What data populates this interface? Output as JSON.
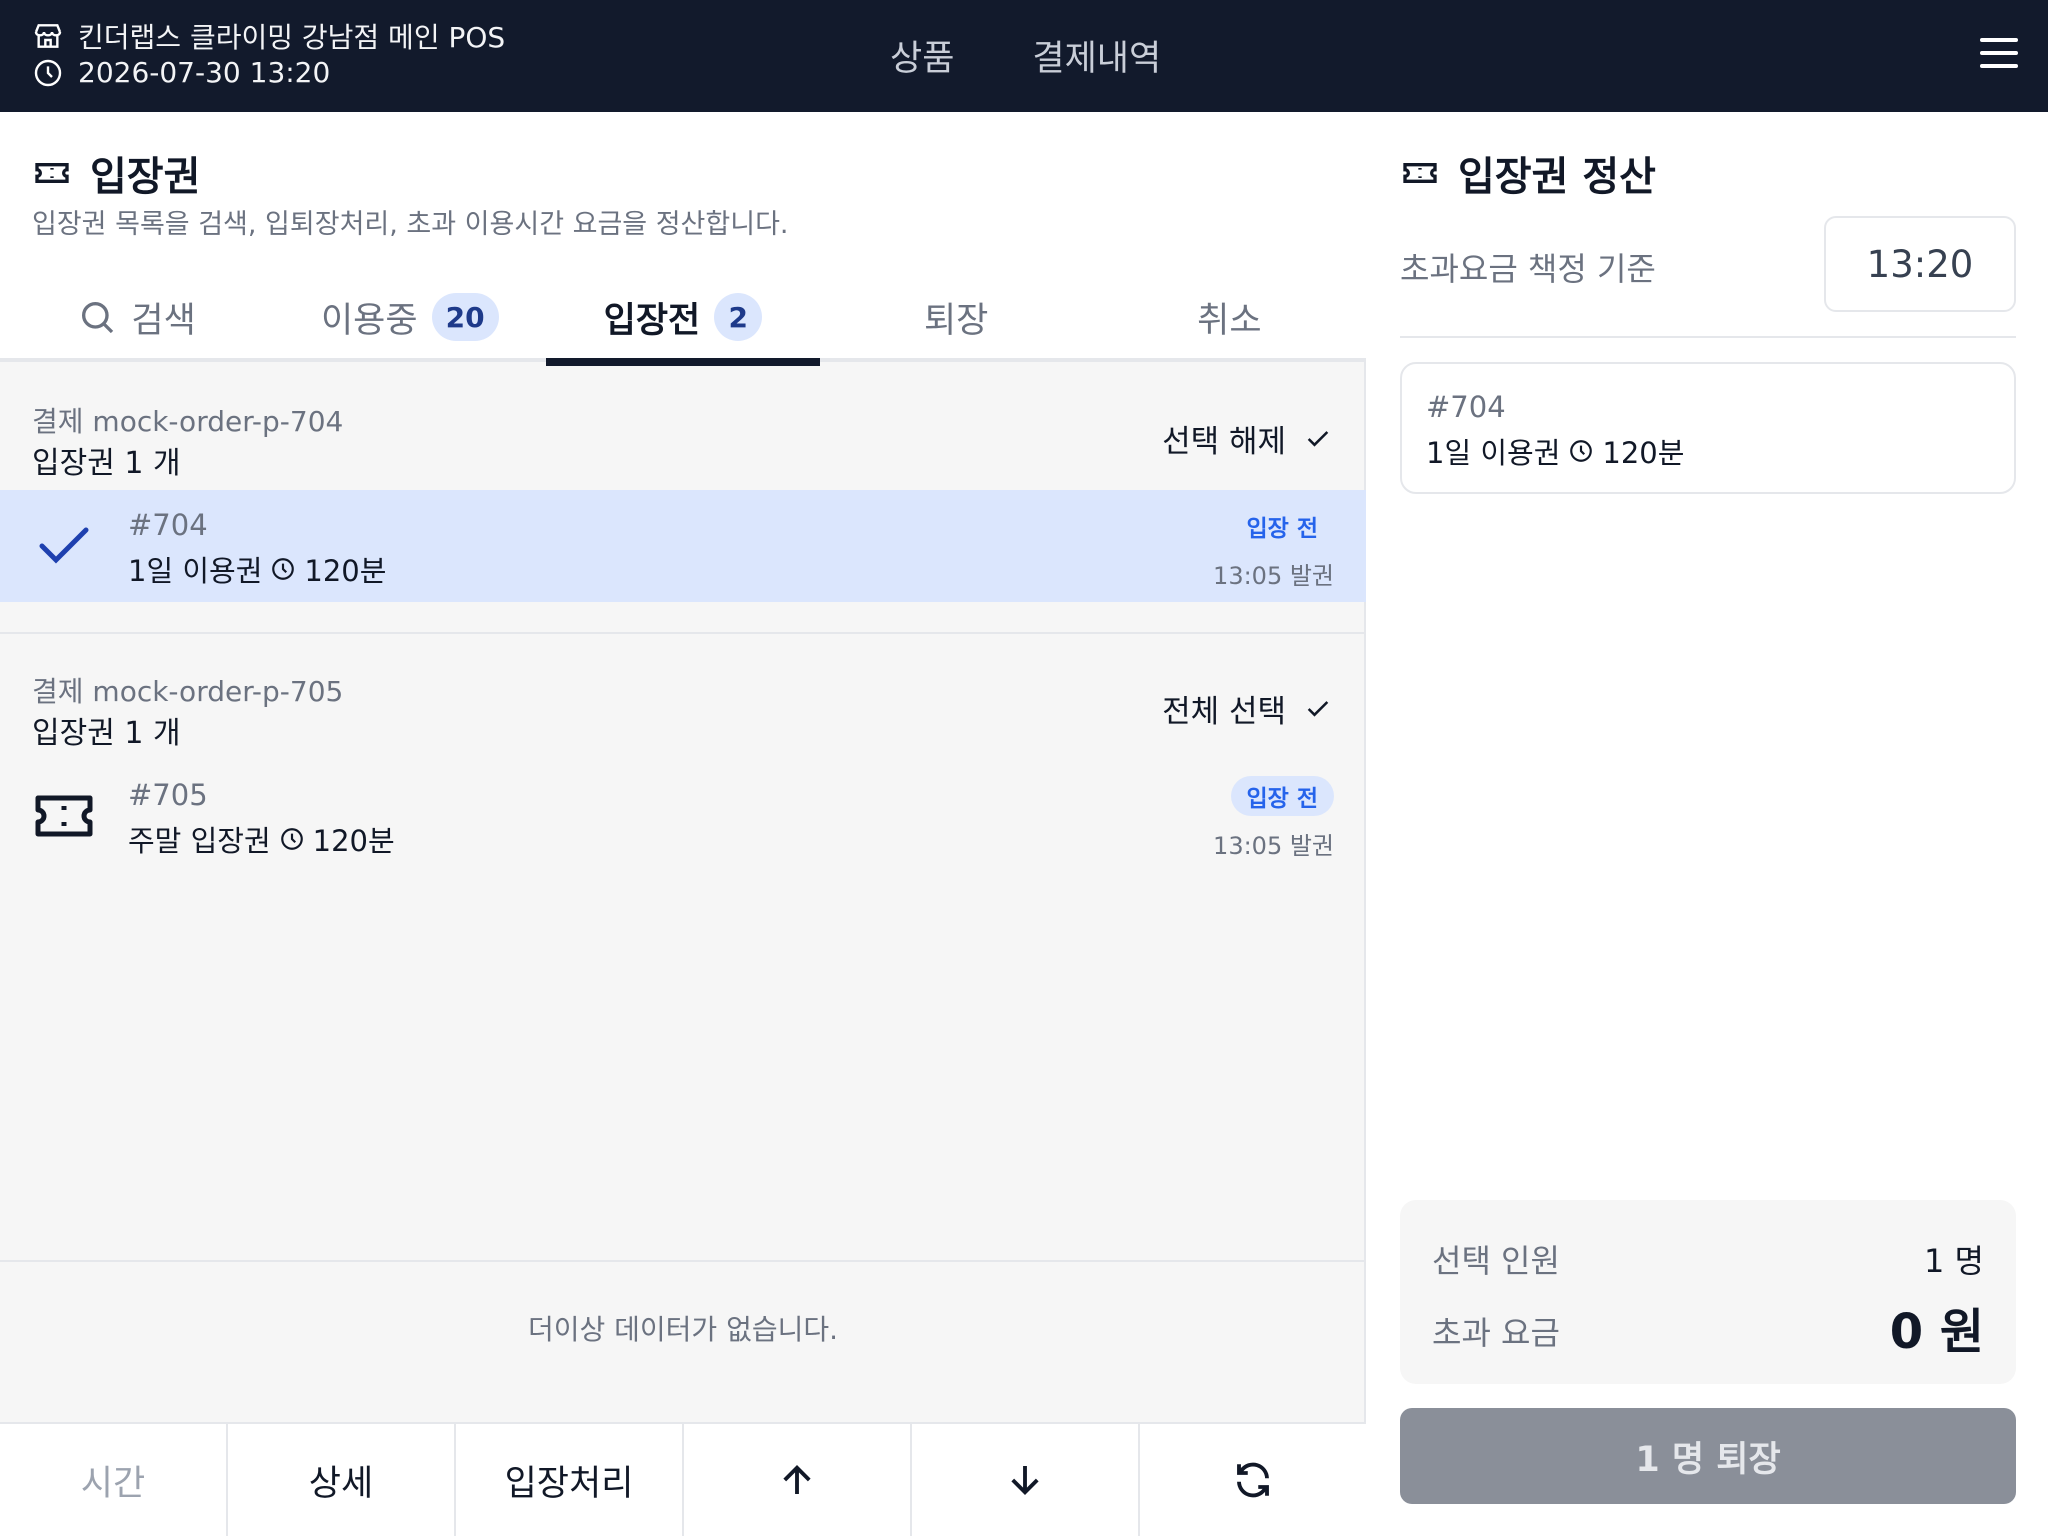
{
  "header": {
    "store_name": "킨더랩스 클라이밍 강남점 메인 POS",
    "datetime": "2026-07-30 13:20",
    "nav": [
      {
        "label": "상품"
      },
      {
        "label": "결제내역"
      }
    ],
    "icons": {
      "store": "store-icon",
      "clock": "clock-icon",
      "menu": "menu-icon"
    }
  },
  "left": {
    "title": "입장권",
    "subtitle": "입장권 목록을 검색, 입퇴장처리, 초과 이용시간 요금을 정산합니다.",
    "tabs": [
      {
        "label": "검색",
        "icon": "search-icon"
      },
      {
        "label": "이용중",
        "badge": "20"
      },
      {
        "label": "입장전",
        "badge": "2",
        "active": true
      },
      {
        "label": "퇴장"
      },
      {
        "label": "취소"
      }
    ],
    "groups": [
      {
        "order": "결제 mock-order-p-704",
        "count": "입장권 1 개",
        "select_label": "선택 해제",
        "tickets": [
          {
            "id": "#704",
            "product": "1일 이용권",
            "duration": "120분",
            "status": "입장 전",
            "issued": "13:05 발권",
            "selected": true
          }
        ]
      },
      {
        "order": "결제 mock-order-p-705",
        "count": "입장권 1 개",
        "select_label": "전체 선택",
        "tickets": [
          {
            "id": "#705",
            "product": "주말 입장권",
            "duration": "120분",
            "status": "입장 전",
            "issued": "13:05 발권",
            "selected": false
          }
        ]
      }
    ],
    "empty_text": "더이상 데이터가 없습니다.",
    "toolbar": [
      {
        "label": "시간"
      },
      {
        "label": "상세"
      },
      {
        "label": "입장처리"
      },
      {
        "icon": "arrow-up-icon"
      },
      {
        "icon": "arrow-down-icon"
      },
      {
        "icon": "refresh-icon"
      }
    ]
  },
  "right": {
    "title": "입장권 정산",
    "basis_label": "초과요금 책정 기준",
    "basis_time": "13:20",
    "selected_ticket": {
      "id": "#704",
      "product": "1일 이용권",
      "duration": "120분"
    },
    "summary": {
      "people_label": "선택 인원",
      "people_value": "1 명",
      "fee_label": "초과 요금",
      "fee_value": "0 원"
    },
    "action_label": "1 명 퇴장"
  },
  "colors": {
    "header_bg": "#121a2c",
    "selected_bg": "#dbe6fd",
    "status_text": "#2563eb",
    "button_disabled": "#8a8f99"
  }
}
